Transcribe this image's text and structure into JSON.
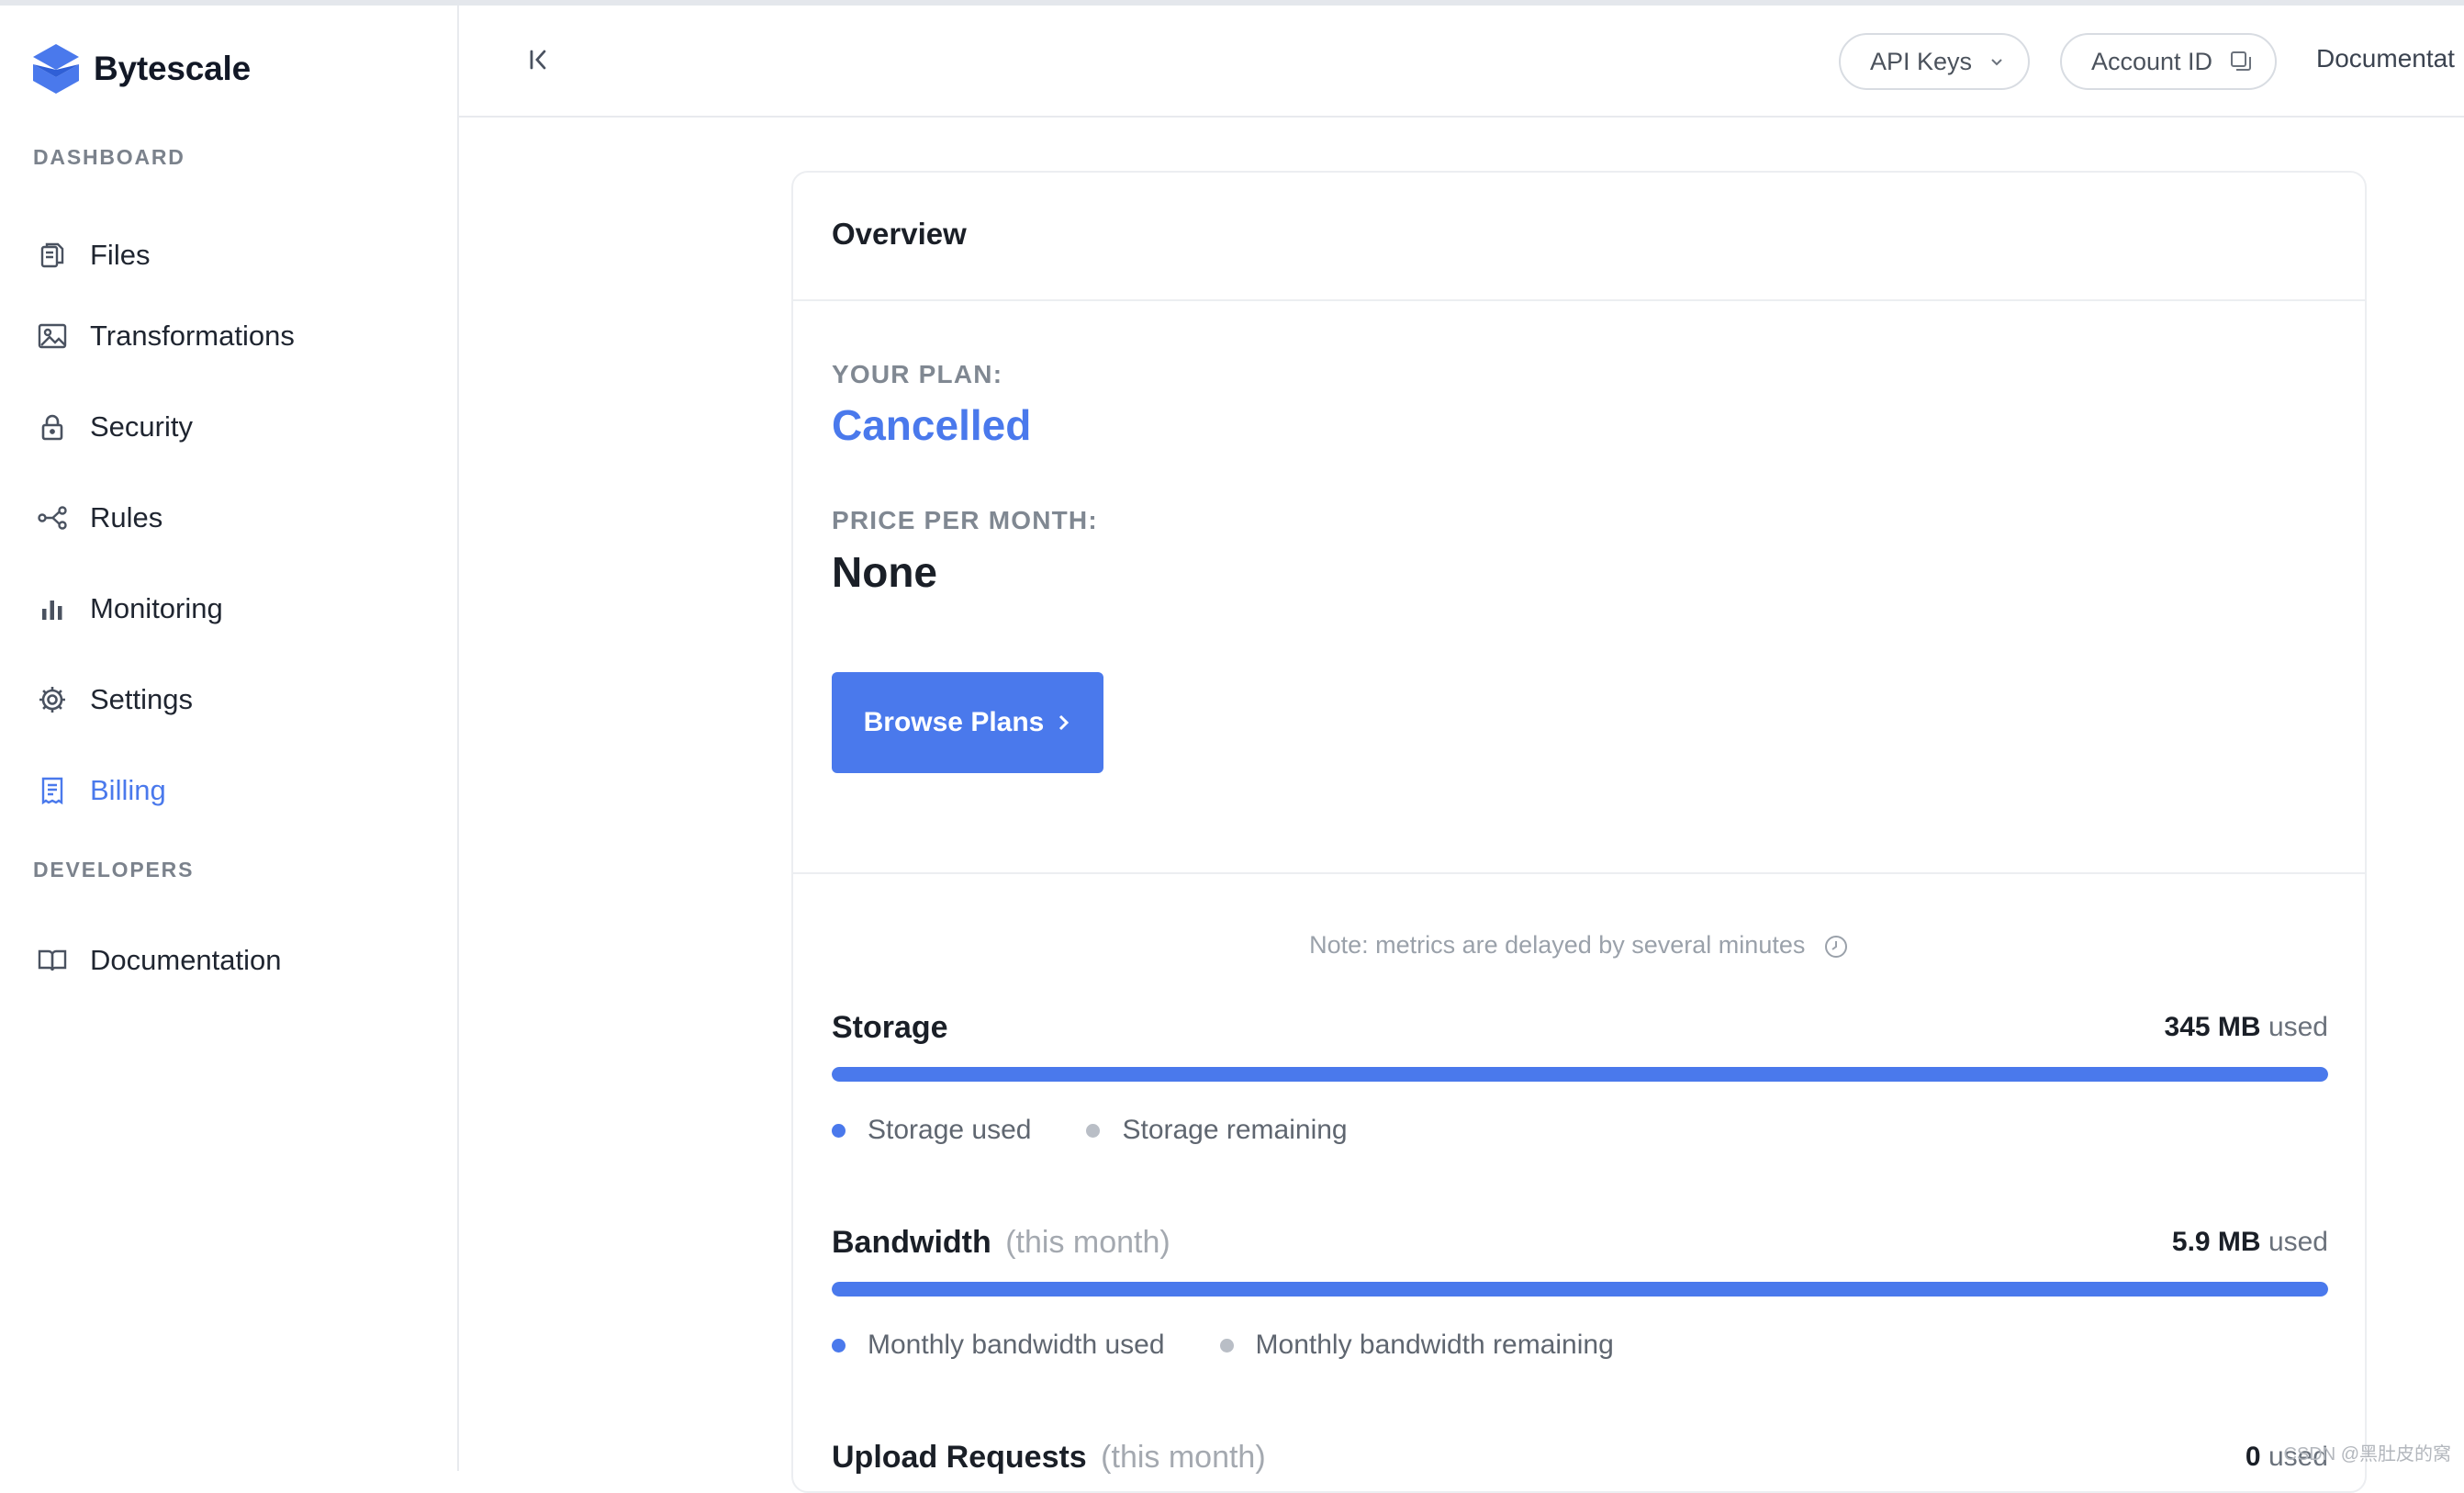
{
  "brand": {
    "name": "Bytescale",
    "accent": "#4a79ec"
  },
  "sidebar": {
    "sections": [
      {
        "label": "DASHBOARD"
      },
      {
        "label": "DEVELOPERS"
      }
    ],
    "items": [
      {
        "label": "Files",
        "icon": "files-icon"
      },
      {
        "label": "Transformations",
        "icon": "image-icon"
      },
      {
        "label": "Security",
        "icon": "lock-icon"
      },
      {
        "label": "Rules",
        "icon": "share-nodes-icon"
      },
      {
        "label": "Monitoring",
        "icon": "bar-chart-icon"
      },
      {
        "label": "Settings",
        "icon": "gear-icon"
      },
      {
        "label": "Billing",
        "icon": "receipt-icon",
        "active": true
      },
      {
        "label": "Documentation",
        "icon": "book-icon"
      }
    ]
  },
  "topbar": {
    "api_keys": "API Keys",
    "account_id": "Account ID",
    "documentation": "Documentat"
  },
  "card": {
    "title": "Overview",
    "plan_label": "YOUR PLAN:",
    "plan_value": "Cancelled",
    "price_label": "PRICE PER MONTH:",
    "price_value": "None",
    "browse_button": "Browse Plans",
    "note": "Note: metrics are delayed by several minutes",
    "metrics": [
      {
        "title": "Storage",
        "subtitle": "",
        "used_value": "345 MB",
        "used_suffix": "used",
        "fill_fraction": 1.0,
        "legend": [
          "Storage used",
          "Storage remaining"
        ]
      },
      {
        "title": "Bandwidth",
        "subtitle": "(this month)",
        "used_value": "5.9 MB",
        "used_suffix": "used",
        "fill_fraction": 1.0,
        "legend": [
          "Monthly bandwidth used",
          "Monthly bandwidth remaining"
        ]
      },
      {
        "title": "Upload Requests",
        "subtitle": "(this month)",
        "used_value": "0",
        "used_suffix": "used"
      }
    ]
  },
  "colors": {
    "used_dot": "#4a79ec",
    "remaining_dot": "#b9bec6"
  },
  "watermark": "CSDN @黑肚皮的窝"
}
